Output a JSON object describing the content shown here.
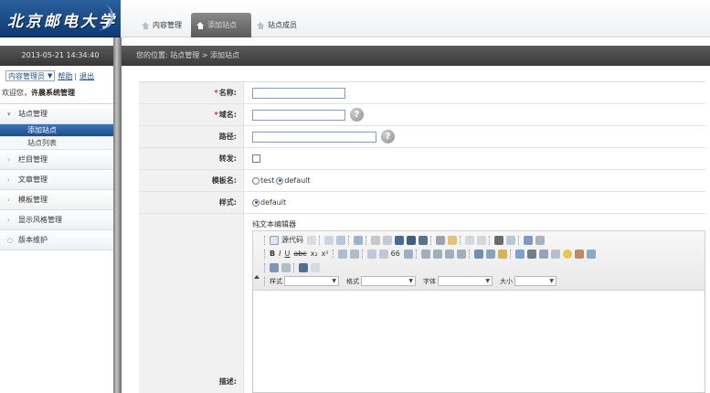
{
  "logo": {
    "text": "北京邮电大学"
  },
  "datetime": "2013-05-21  14:34:40",
  "user_bar": {
    "module_select_value": "内容管理员",
    "help_label": "帮助",
    "separator": "|",
    "logout_label": "退出",
    "welcome_prefix": "欢迎您，",
    "welcome_user": "许晨系统管理"
  },
  "sidebar": {
    "items": [
      {
        "label": "站点管理",
        "icon": "expanded-arrow-icon",
        "subitems": [
          {
            "label": "添加站点"
          },
          {
            "label": "站点列表"
          }
        ]
      },
      {
        "label": "栏目管理",
        "icon": "collapsed-arrow-icon"
      },
      {
        "label": "文章管理",
        "icon": "collapsed-arrow-icon"
      },
      {
        "label": "模板管理",
        "icon": "collapsed-arrow-icon"
      },
      {
        "label": "显示风格管理",
        "icon": "collapsed-arrow-icon"
      },
      {
        "label": "版本维护",
        "icon": "circle-bullet-icon"
      }
    ]
  },
  "tabs": [
    {
      "label": "内容管理"
    },
    {
      "label": "添加站点"
    },
    {
      "label": "站点成员"
    }
  ],
  "breadcrumb": "您的位置: 站点管理 > 添加站点",
  "form": {
    "name_label": "名称:",
    "domain_label": "域名:",
    "path_label": "路径:",
    "publish_label": "转发:",
    "template_label": "模板名:",
    "template_options": [
      "test",
      "default"
    ],
    "template_selected": "default",
    "style_label": "样式:",
    "style_options": [
      "default"
    ],
    "style_selected": "default",
    "description_label": "描述:",
    "required_mark": "*"
  },
  "editor": {
    "title": "纯文本编辑器",
    "source_button": "源代码",
    "combo_style": "样式",
    "combo_format": "格式",
    "combo_font": "字体",
    "combo_size": "大小"
  },
  "colors": {
    "accent_blue": "#1b4c8e",
    "header_dark": "#3a3a3a",
    "label_bg": "#f1f1f1",
    "required_red": "#dd2222"
  }
}
